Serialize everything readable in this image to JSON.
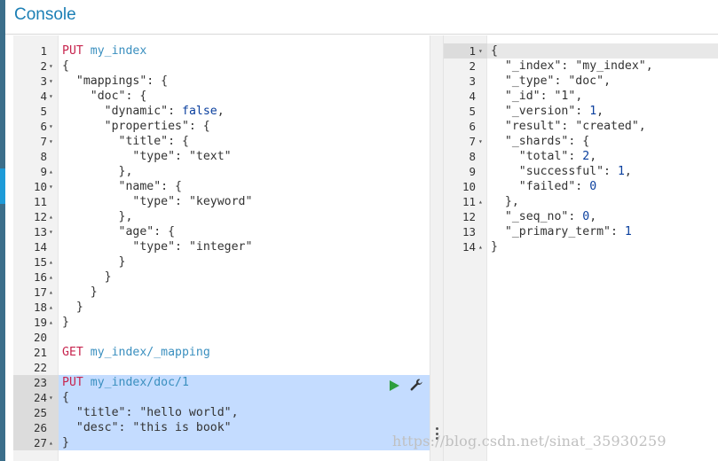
{
  "app": {
    "title": "Console"
  },
  "request_editor": {
    "lines": [
      {
        "n": "1",
        "f": "",
        "code": [
          [
            "m",
            "PUT"
          ],
          [
            "k",
            " "
          ],
          [
            "u",
            "my_index"
          ]
        ]
      },
      {
        "n": "2",
        "f": "▾",
        "code": [
          [
            "k",
            "{"
          ]
        ]
      },
      {
        "n": "3",
        "f": "▾",
        "code": [
          [
            "k",
            "  "
          ],
          [
            "s",
            "\"mappings\""
          ],
          [
            "k",
            ": {"
          ]
        ]
      },
      {
        "n": "4",
        "f": "▾",
        "code": [
          [
            "k",
            "    "
          ],
          [
            "s",
            "\"doc\""
          ],
          [
            "k",
            ": {"
          ]
        ]
      },
      {
        "n": "5",
        "f": "",
        "code": [
          [
            "k",
            "      "
          ],
          [
            "s",
            "\"dynamic\""
          ],
          [
            "k",
            ": "
          ],
          [
            "b",
            "false"
          ],
          [
            "k",
            ","
          ]
        ]
      },
      {
        "n": "6",
        "f": "▾",
        "code": [
          [
            "k",
            "      "
          ],
          [
            "s",
            "\"properties\""
          ],
          [
            "k",
            ": {"
          ]
        ]
      },
      {
        "n": "7",
        "f": "▾",
        "code": [
          [
            "k",
            "        "
          ],
          [
            "s",
            "\"title\""
          ],
          [
            "k",
            ": {"
          ]
        ]
      },
      {
        "n": "8",
        "f": "",
        "code": [
          [
            "k",
            "          "
          ],
          [
            "s",
            "\"type\""
          ],
          [
            "k",
            ": "
          ],
          [
            "s",
            "\"text\""
          ]
        ]
      },
      {
        "n": "9",
        "f": "▴",
        "code": [
          [
            "k",
            "        },"
          ]
        ]
      },
      {
        "n": "10",
        "f": "▾",
        "code": [
          [
            "k",
            "        "
          ],
          [
            "s",
            "\"name\""
          ],
          [
            "k",
            ": {"
          ]
        ]
      },
      {
        "n": "11",
        "f": "",
        "code": [
          [
            "k",
            "          "
          ],
          [
            "s",
            "\"type\""
          ],
          [
            "k",
            ": "
          ],
          [
            "s",
            "\"keyword\""
          ]
        ]
      },
      {
        "n": "12",
        "f": "▴",
        "code": [
          [
            "k",
            "        },"
          ]
        ]
      },
      {
        "n": "13",
        "f": "▾",
        "code": [
          [
            "k",
            "        "
          ],
          [
            "s",
            "\"age\""
          ],
          [
            "k",
            ": {"
          ]
        ]
      },
      {
        "n": "14",
        "f": "",
        "code": [
          [
            "k",
            "          "
          ],
          [
            "s",
            "\"type\""
          ],
          [
            "k",
            ": "
          ],
          [
            "s",
            "\"integer\""
          ]
        ]
      },
      {
        "n": "15",
        "f": "▴",
        "code": [
          [
            "k",
            "        }"
          ]
        ]
      },
      {
        "n": "16",
        "f": "▴",
        "code": [
          [
            "k",
            "      }"
          ]
        ]
      },
      {
        "n": "17",
        "f": "▴",
        "code": [
          [
            "k",
            "    }"
          ]
        ]
      },
      {
        "n": "18",
        "f": "▴",
        "code": [
          [
            "k",
            "  }"
          ]
        ]
      },
      {
        "n": "19",
        "f": "▴",
        "code": [
          [
            "k",
            "}"
          ]
        ]
      },
      {
        "n": "20",
        "f": "",
        "code": []
      },
      {
        "n": "21",
        "f": "",
        "code": [
          [
            "m",
            "GET"
          ],
          [
            "k",
            " "
          ],
          [
            "u",
            "my_index/_mapping"
          ]
        ]
      },
      {
        "n": "22",
        "f": "",
        "code": []
      },
      {
        "n": "23",
        "f": "",
        "code": [
          [
            "m",
            "PUT"
          ],
          [
            "k",
            " "
          ],
          [
            "u",
            "my_index/doc/1"
          ]
        ],
        "hl": true,
        "cursor": true
      },
      {
        "n": "24",
        "f": "▾",
        "code": [
          [
            "k",
            "{"
          ]
        ],
        "hl": true
      },
      {
        "n": "25",
        "f": "",
        "code": [
          [
            "k",
            "  "
          ],
          [
            "s",
            "\"title\""
          ],
          [
            "k",
            ": "
          ],
          [
            "s",
            "\"hello world\""
          ],
          [
            "k",
            ","
          ]
        ],
        "hl": true
      },
      {
        "n": "26",
        "f": "",
        "code": [
          [
            "k",
            "  "
          ],
          [
            "s",
            "\"desc\""
          ],
          [
            "k",
            ": "
          ],
          [
            "s",
            "\"this is book\""
          ]
        ],
        "hl": true
      },
      {
        "n": "27",
        "f": "▴",
        "code": [
          [
            "k",
            "}"
          ]
        ],
        "hl": true
      }
    ]
  },
  "response_viewer": {
    "lines": [
      {
        "n": "1",
        "f": "▾",
        "code": [
          [
            "k",
            "{"
          ]
        ],
        "cursor": true
      },
      {
        "n": "2",
        "f": "",
        "code": [
          [
            "k",
            "  "
          ],
          [
            "s",
            "\"_index\""
          ],
          [
            "k",
            ": "
          ],
          [
            "s",
            "\"my_index\""
          ],
          [
            "k",
            ","
          ]
        ]
      },
      {
        "n": "3",
        "f": "",
        "code": [
          [
            "k",
            "  "
          ],
          [
            "s",
            "\"_type\""
          ],
          [
            "k",
            ": "
          ],
          [
            "s",
            "\"doc\""
          ],
          [
            "k",
            ","
          ]
        ]
      },
      {
        "n": "4",
        "f": "",
        "code": [
          [
            "k",
            "  "
          ],
          [
            "s",
            "\"_id\""
          ],
          [
            "k",
            ": "
          ],
          [
            "s",
            "\"1\""
          ],
          [
            "k",
            ","
          ]
        ]
      },
      {
        "n": "5",
        "f": "",
        "code": [
          [
            "k",
            "  "
          ],
          [
            "s",
            "\"_version\""
          ],
          [
            "k",
            ": "
          ],
          [
            "n",
            "1"
          ],
          [
            "k",
            ","
          ]
        ]
      },
      {
        "n": "6",
        "f": "",
        "code": [
          [
            "k",
            "  "
          ],
          [
            "s",
            "\"result\""
          ],
          [
            "k",
            ": "
          ],
          [
            "s",
            "\"created\""
          ],
          [
            "k",
            ","
          ]
        ]
      },
      {
        "n": "7",
        "f": "▾",
        "code": [
          [
            "k",
            "  "
          ],
          [
            "s",
            "\"_shards\""
          ],
          [
            "k",
            ": {"
          ]
        ]
      },
      {
        "n": "8",
        "f": "",
        "code": [
          [
            "k",
            "    "
          ],
          [
            "s",
            "\"total\""
          ],
          [
            "k",
            ": "
          ],
          [
            "n",
            "2"
          ],
          [
            "k",
            ","
          ]
        ]
      },
      {
        "n": "9",
        "f": "",
        "code": [
          [
            "k",
            "    "
          ],
          [
            "s",
            "\"successful\""
          ],
          [
            "k",
            ": "
          ],
          [
            "n",
            "1"
          ],
          [
            "k",
            ","
          ]
        ]
      },
      {
        "n": "10",
        "f": "",
        "code": [
          [
            "k",
            "    "
          ],
          [
            "s",
            "\"failed\""
          ],
          [
            "k",
            ": "
          ],
          [
            "n",
            "0"
          ]
        ]
      },
      {
        "n": "11",
        "f": "▴",
        "code": [
          [
            "k",
            "  },"
          ]
        ]
      },
      {
        "n": "12",
        "f": "",
        "code": [
          [
            "k",
            "  "
          ],
          [
            "s",
            "\"_seq_no\""
          ],
          [
            "k",
            ": "
          ],
          [
            "n",
            "0"
          ],
          [
            "k",
            ","
          ]
        ]
      },
      {
        "n": "13",
        "f": "",
        "code": [
          [
            "k",
            "  "
          ],
          [
            "s",
            "\"_primary_term\""
          ],
          [
            "k",
            ": "
          ],
          [
            "n",
            "1"
          ]
        ]
      },
      {
        "n": "14",
        "f": "▴",
        "code": [
          [
            "k",
            "}"
          ]
        ]
      }
    ]
  },
  "toolbar": {
    "run_icon": "play-icon",
    "settings_icon": "wrench-icon"
  },
  "watermark": {
    "text": "https://blog.csdn.net/sinat_35930259"
  },
  "colors": {
    "method": "#c7254e",
    "url": "#3a8fbf",
    "keyword": "#0a3f9e",
    "selection": "#c4dcff",
    "title": "#1c7fb5"
  }
}
